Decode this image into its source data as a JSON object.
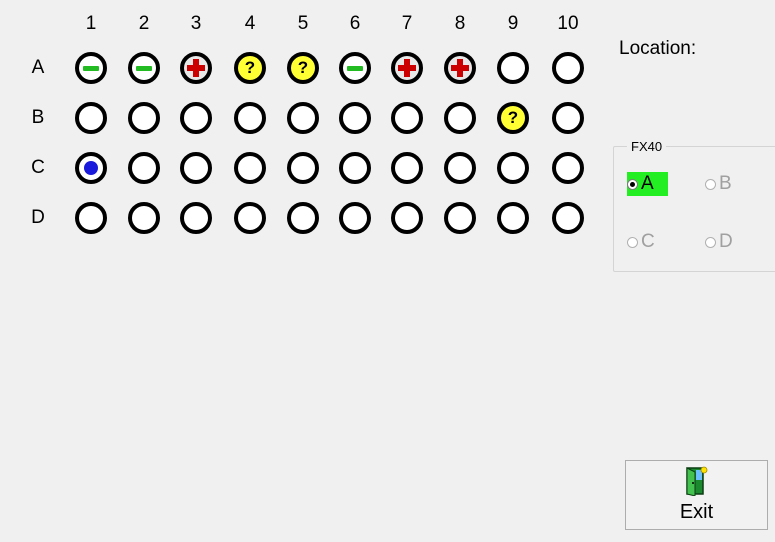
{
  "grid": {
    "columns": [
      "1",
      "2",
      "3",
      "4",
      "5",
      "6",
      "7",
      "8",
      "9",
      "10"
    ],
    "rows": [
      {
        "label": "A",
        "wells": [
          "negative",
          "negative",
          "positive",
          "unknown",
          "unknown",
          "negative",
          "positive",
          "positive",
          "empty",
          "empty"
        ]
      },
      {
        "label": "B",
        "wells": [
          "empty",
          "empty",
          "empty",
          "empty",
          "empty",
          "empty",
          "empty",
          "empty",
          "unknown",
          "empty"
        ]
      },
      {
        "label": "C",
        "wells": [
          "selected",
          "empty",
          "empty",
          "empty",
          "empty",
          "empty",
          "empty",
          "empty",
          "empty",
          "empty"
        ]
      },
      {
        "label": "D",
        "wells": [
          "empty",
          "empty",
          "empty",
          "empty",
          "empty",
          "empty",
          "empty",
          "empty",
          "empty",
          "empty"
        ]
      }
    ],
    "unknown_symbol": "?",
    "colors": {
      "negative": "#22bb22",
      "positive": "#cc0000",
      "unknown": "#ffff33",
      "selected": "#1a1adc"
    }
  },
  "location": {
    "label": "Location:"
  },
  "fx40": {
    "title": "FX40",
    "options": [
      {
        "label": "A",
        "checked": true,
        "enabled": true
      },
      {
        "label": "B",
        "checked": false,
        "enabled": false
      },
      {
        "label": "C",
        "checked": false,
        "enabled": false
      },
      {
        "label": "D",
        "checked": false,
        "enabled": false
      }
    ],
    "active_color": "#22ee22"
  },
  "exit_button": {
    "label": "Exit",
    "icon": "exit-door-icon"
  }
}
